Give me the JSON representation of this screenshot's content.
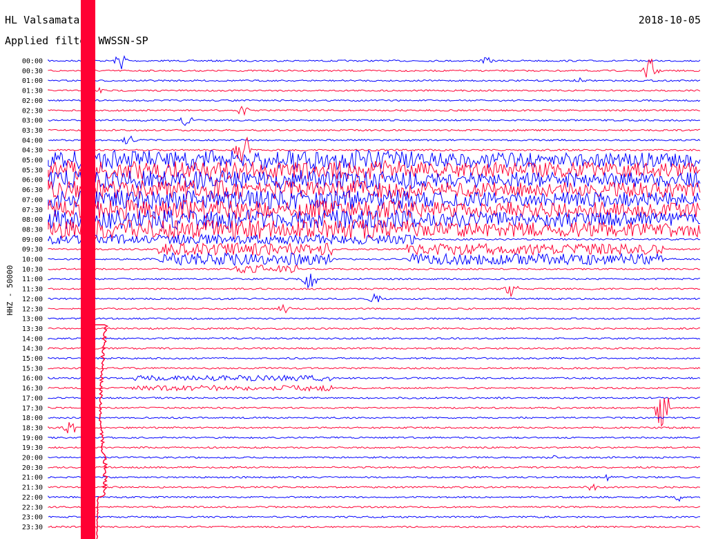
{
  "header": {
    "station": "HL Valsamata",
    "filter": "Applied filter WWSSN-SP",
    "date": "2018-10-05"
  },
  "chart_data": {
    "type": "line",
    "ylabel": "HHZ - 50000",
    "colors": {
      "blue": "#0000ff",
      "red": "#ff0033"
    },
    "y_tick_labels": [
      "00:00",
      "00:30",
      "01:00",
      "01:30",
      "02:00",
      "02:30",
      "03:00",
      "03:30",
      "04:00",
      "04:30",
      "05:00",
      "05:30",
      "06:00",
      "06:30",
      "07:00",
      "07:30",
      "08:00",
      "08:30",
      "09:00",
      "09:30",
      "10:00",
      "10:30",
      "11:00",
      "11:30",
      "12:00",
      "12:30",
      "13:00",
      "13:30",
      "14:00",
      "14:30",
      "15:00",
      "15:30",
      "16:00",
      "16:30",
      "17:00",
      "17:30",
      "18:00",
      "18:30",
      "19:00",
      "19:30",
      "20:00",
      "20:30",
      "21:00",
      "21:30",
      "22:00",
      "22:30",
      "23:00",
      "23:30"
    ],
    "series_pattern": [
      "blue",
      "red"
    ],
    "grid": false
  }
}
